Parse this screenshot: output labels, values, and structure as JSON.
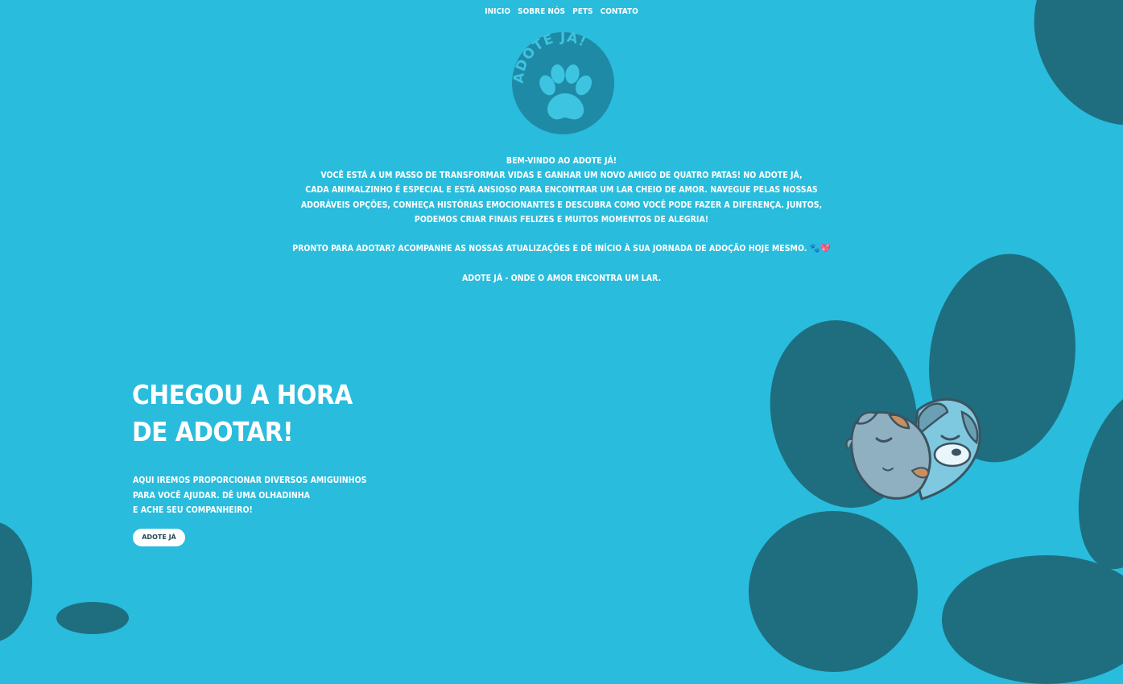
{
  "nav": {
    "items": [
      "INICIO",
      "SOBRE NÓS",
      "PETS",
      "CONTATO"
    ]
  },
  "logo": {
    "text": "ADOTE JÁ!",
    "icon": "paw-icon"
  },
  "intro": {
    "title": "BEM-VINDO AO ADOTE JÁ!",
    "lines": [
      "VOCÊ ESTÁ A UM PASSO DE TRANSFORMAR VIDAS E GANHAR UM NOVO AMIGO DE QUATRO PATAS! NO ADOTE JÁ,",
      "CADA ANIMALZINHO É ESPECIAL E ESTÁ ANSIOSO PARA ENCONTRAR UM LAR CHEIO DE AMOR. NAVEGUE PELAS NOSSAS",
      "ADORÁVEIS OPÇÕES, CONHEÇA HISTÓRIAS EMOCIONANTES E DESCUBRA COMO VOCÊ PODE FAZER A DIFERENÇA. JUNTOS,",
      "PODEMOS CRIAR FINAIS FELIZES E MUITOS MOMENTOS DE ALEGRIA!"
    ],
    "cta_line": "PRONTO PARA ADOTAR? ACOMPANHE AS NOSSAS ATUALIZAÇÕES E DÊ INÍCIO À SUA JORNADA DE ADOÇÃO HOJE MESMO. 🐾💖",
    "tagline": "ADOTE JÁ - ONDE O AMOR ENCONTRA UM LAR."
  },
  "hero": {
    "title_line1": "CHEGOU A HORA",
    "title_line2": "DE ADOTAR!",
    "text_lines": [
      "AQUI IREMOS PROPORCIONAR DIVERSOS AMIGUINHOS",
      "PARA VOCÊ AJUDAR. DÊ UMA OLHADINHA",
      "E ACHE SEU COMPANHEIRO!"
    ],
    "button_label": "ADOTE JÁ"
  },
  "colors": {
    "background": "#29bcdd",
    "blob": "#1f6e80",
    "logo_circle": "#1f8aa6",
    "text": "#ffffff"
  }
}
